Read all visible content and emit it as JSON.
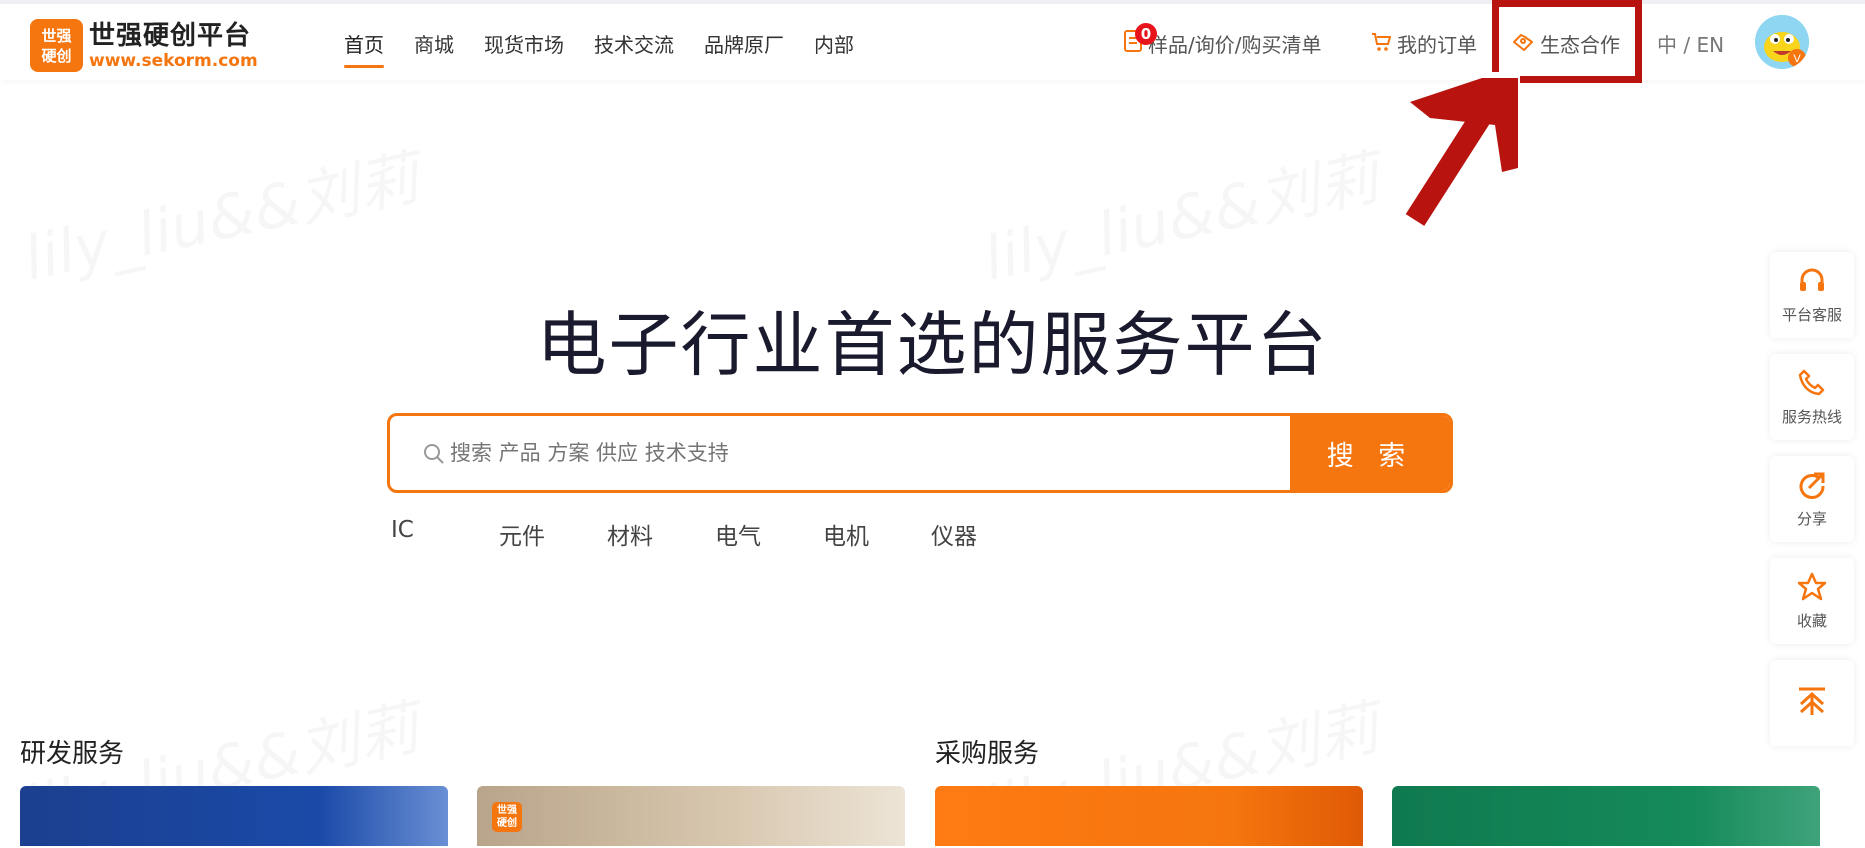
{
  "brand": {
    "logo_line1": "世强",
    "logo_line2": "硬创",
    "name": "世强硬创平台",
    "url": "www.sekorm.com"
  },
  "nav": {
    "items": [
      "首页",
      "商城",
      "现货市场",
      "技术交流",
      "品牌原厂",
      "内部"
    ]
  },
  "header_right": {
    "cart_count": "0",
    "cart_label": "样品/询价/购买清单",
    "orders_label": "我的订单",
    "partner_label": "生态合作",
    "lang_label": "中 / EN"
  },
  "hero": {
    "title": "电子行业首选的服务平台"
  },
  "search": {
    "placeholder": "搜索 产品 方案 供应 技术支持",
    "button_label": "搜 索"
  },
  "categories": [
    "IC",
    "元件",
    "材料",
    "电气",
    "电机",
    "仪器"
  ],
  "sections": {
    "rd_title": "研发服务",
    "purchase_title": "采购服务"
  },
  "sidebar": {
    "items": [
      "平台客服",
      "服务热线",
      "分享",
      "收藏"
    ]
  },
  "watermark_text": "lily_liu&&刘莉",
  "colors": {
    "accent": "#f5750f",
    "annotation": "#b8130f",
    "badge": "#e8141c"
  }
}
